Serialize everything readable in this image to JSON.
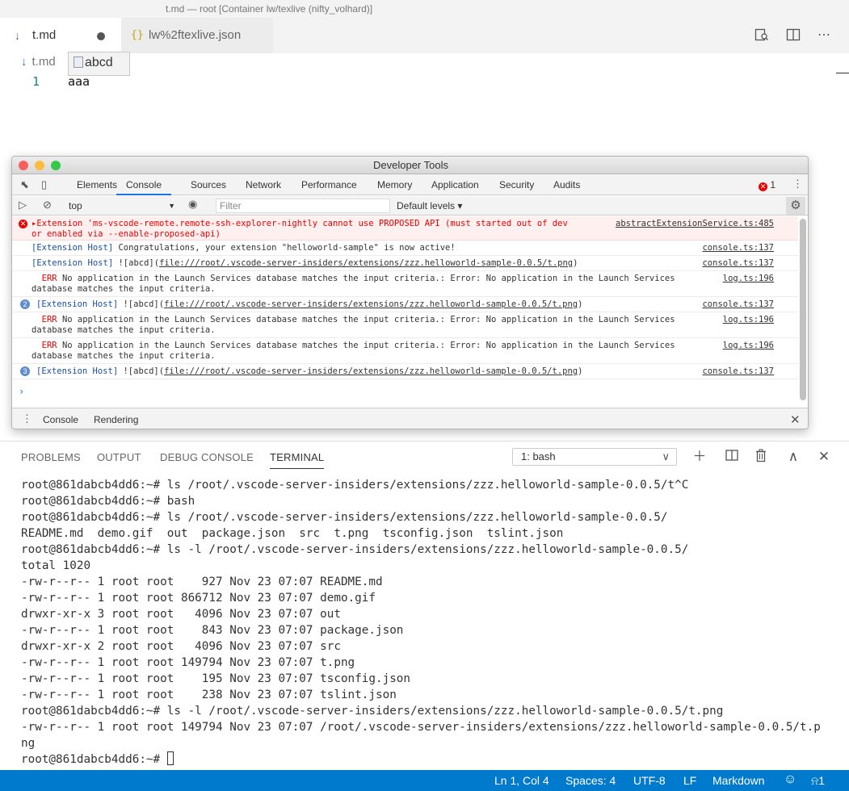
{
  "window": {
    "title": "t.md — root [Container lw/texlive (nifty_volhard)]"
  },
  "tabs": [
    {
      "label": "t.md",
      "icon": "markdown-icon",
      "dirty": true
    },
    {
      "label": "lw%2ftexlive.json",
      "icon": "json-braces-icon"
    }
  ],
  "editor": {
    "breadcrumb": "t.md",
    "image_tooltip_alt": "abcd",
    "line_number": "1",
    "line_text": "aaa"
  },
  "devtools": {
    "title": "Developer Tools",
    "tabs": [
      "Elements",
      "Console",
      "Sources",
      "Network",
      "Performance",
      "Memory",
      "Application",
      "Security",
      "Audits"
    ],
    "selected_tab": "Console",
    "error_count": "1",
    "context": "top",
    "filter_placeholder": "Filter",
    "levels": "Default levels ▾",
    "messages": {
      "m1_text": "Extension 'ms-vscode-remote.remote-ssh-explorer-nightly cannot use PROPOSED API (must started out of dev\nor enabled via --enable-proposed-api)",
      "m1_src": "abstractExtensionService.ts:485",
      "m2_prefix": "[Extension Host]",
      "m2_text": " Congratulations, your extension \"helloworld-sample\" is now active!",
      "m2_src": "console.ts:137",
      "m3_prefix": "[Extension Host]",
      "m3_text": " ![abcd](",
      "m3_link": "file:///root/.vscode-server-insiders/extensions/zzz.helloworld-sample-0.0.5/t.png",
      "m3_tail": ")",
      "m3_src": "console.ts:137",
      "err_tag": "ERR",
      "err_text": " No application in the Launch Services database matches the input criteria.: Error: No application in the Launch Services\ndatabase matches the input criteria.",
      "err_src": "log.ts:196",
      "m5_count": "2",
      "m8_count": "3",
      "ext_src": "console.ts:137"
    },
    "drawer_tabs": [
      "Console",
      "Rendering"
    ]
  },
  "panel": {
    "tabs": [
      "PROBLEMS",
      "OUTPUT",
      "DEBUG CONSOLE",
      "TERMINAL"
    ],
    "selected": "TERMINAL",
    "terminal_select": "1: bash"
  },
  "terminal": {
    "lines": [
      "root@861dabcb4dd6:~# ls /root/.vscode-server-insiders/extensions/zzz.helloworld-sample-0.0.5/t^C",
      "root@861dabcb4dd6:~# bash",
      "root@861dabcb4dd6:~# ls /root/.vscode-server-insiders/extensions/zzz.helloworld-sample-0.0.5/",
      "README.md  demo.gif  out  package.json  src  t.png  tsconfig.json  tslint.json",
      "root@861dabcb4dd6:~# ls -l /root/.vscode-server-insiders/extensions/zzz.helloworld-sample-0.0.5/",
      "total 1020",
      "-rw-r--r-- 1 root root    927 Nov 23 07:07 README.md",
      "-rw-r--r-- 1 root root 866712 Nov 23 07:07 demo.gif",
      "drwxr-xr-x 3 root root   4096 Nov 23 07:07 out",
      "-rw-r--r-- 1 root root    843 Nov 23 07:07 package.json",
      "drwxr-xr-x 2 root root   4096 Nov 23 07:07 src",
      "-rw-r--r-- 1 root root 149794 Nov 23 07:07 t.png",
      "-rw-r--r-- 1 root root    195 Nov 23 07:07 tsconfig.json",
      "-rw-r--r-- 1 root root    238 Nov 23 07:07 tslint.json",
      "root@861dabcb4dd6:~# ls -l /root/.vscode-server-insiders/extensions/zzz.helloworld-sample-0.0.5/t.png",
      "-rw-r--r-- 1 root root 149794 Nov 23 07:07 /root/.vscode-server-insiders/extensions/zzz.helloworld-sample-0.0.5/t.p",
      "ng"
    ],
    "prompt": "root@861dabcb4dd6:~# "
  },
  "statusbar": {
    "position": "Ln 1, Col 4",
    "spaces": "Spaces: 4",
    "encoding": "UTF-8",
    "eol": "LF",
    "language": "Markdown",
    "notifications": "1"
  },
  "colors": {
    "accent": "#007acc",
    "error": "#e00000",
    "devtools_blue": "#1a73e8"
  }
}
